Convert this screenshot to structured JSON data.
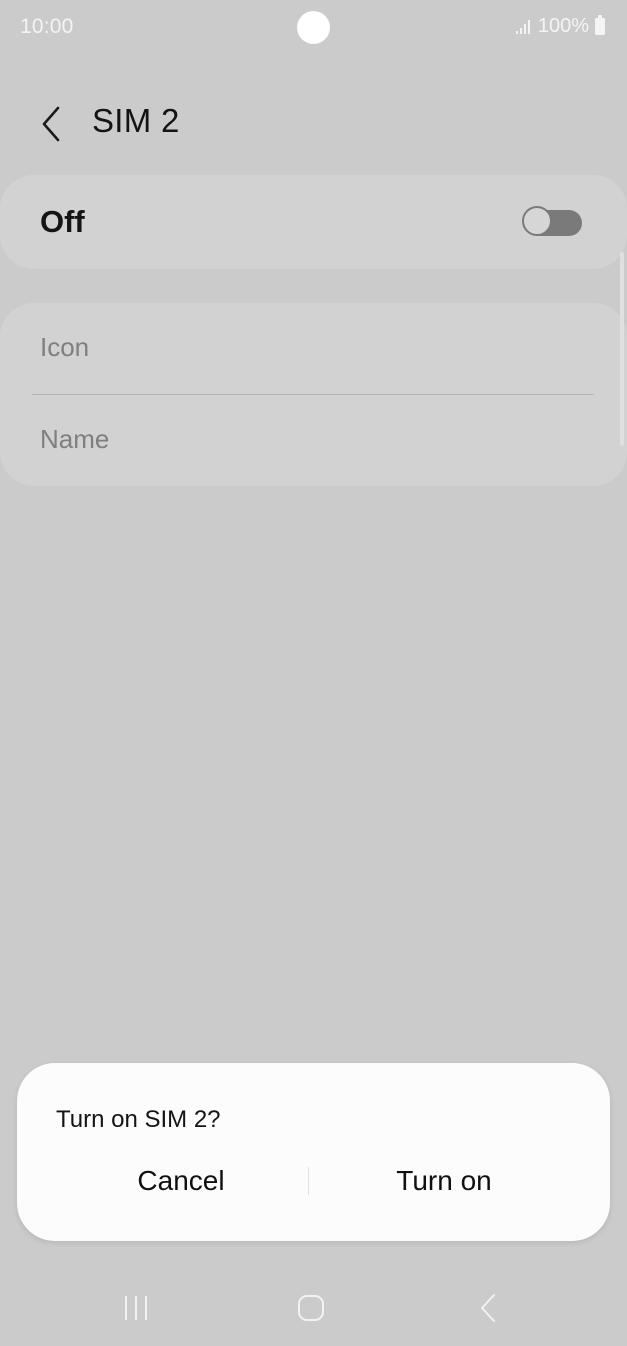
{
  "status_bar": {
    "time": "10:00",
    "battery": "100%",
    "icons": [
      "signal-icon",
      "battery-icon"
    ]
  },
  "header": {
    "title": "SIM 2",
    "back_icon": "chevron-left-icon"
  },
  "sim_toggle": {
    "label": "Off",
    "enabled": false
  },
  "settings": {
    "items": [
      {
        "label": "Icon"
      },
      {
        "label": "Name"
      }
    ]
  },
  "dialog": {
    "title": "Turn on SIM 2?",
    "cancel_label": "Cancel",
    "confirm_label": "Turn on"
  },
  "nav_bar": {
    "icons": [
      "recent-apps-icon",
      "home-icon",
      "back-icon"
    ]
  },
  "colors": {
    "background": "#cbcbcb",
    "card": "#d2d2d2",
    "dialog": "#fcfcfc",
    "switch_off": "#7a7a7a"
  }
}
